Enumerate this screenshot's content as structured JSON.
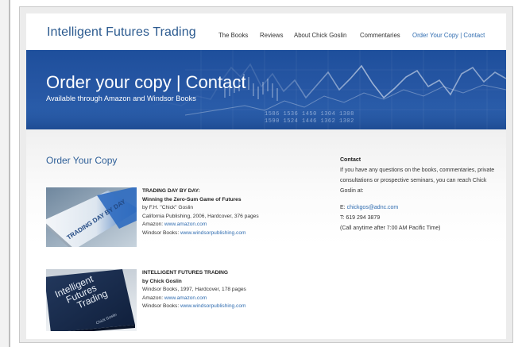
{
  "site": {
    "logo": "Intelligent Futures Trading",
    "nav": [
      {
        "label": "The Books"
      },
      {
        "label": "Reviews"
      },
      {
        "label": "About Chick Goslin"
      },
      {
        "label": "Commentaries"
      },
      {
        "label": "Order Your Copy | Contact",
        "active": true
      }
    ]
  },
  "banner": {
    "title": "Order your copy | Contact",
    "subtitle": "Available through Amazon and Windsor Books",
    "ticker_rows": [
      "1586 1536 1450 1304 1308",
      "1590 1524 1446 1362 1302"
    ]
  },
  "main": {
    "section_title": "Order Your Copy",
    "books": [
      {
        "title": "TRADING DAY BY DAY:",
        "subtitle": "Winning the Zero-Sum Game of Futures",
        "author": "by F.H. \"Chick\" Goslin",
        "pub": "California Publishing, 2006, Hardcover, 376 pages",
        "amazon_label": "Amazon:",
        "amazon_link": "www.amazon.com",
        "windsor_label": "Windsor Books:",
        "windsor_link": "www.windsorpublishing.com",
        "cover_text": "TRADING DAY BY DAY"
      },
      {
        "title": "INTELLIGENT FUTURES TRADING",
        "author": "by Chick Goslin",
        "pub": "Windsor Books, 1997, Hardcover, 178 pages",
        "amazon_label": "Amazon:",
        "amazon_link": "www.amazon.com",
        "windsor_label": "Windsor Books:",
        "windsor_link": "www.windsorpublishing.com",
        "cover_lines": [
          "Intelligent",
          "Futures",
          "Trading"
        ],
        "cover_author": "Chick Goslin"
      }
    ]
  },
  "contact": {
    "heading": "Contact",
    "body": "If you have any questions on the books, commentaries, private consultations or prospective seminars, you can reach Chick Goslin at:",
    "email_label": "E:",
    "email": "chickgos@adnc.com",
    "phone": "T: 619 294 3879",
    "note": "(Call anytime after 7:00 AM Pacific Time)"
  },
  "colors": {
    "brand_blue": "#2b5a8f",
    "link_blue": "#2f6cb0",
    "banner_blue": "#2656a3"
  }
}
